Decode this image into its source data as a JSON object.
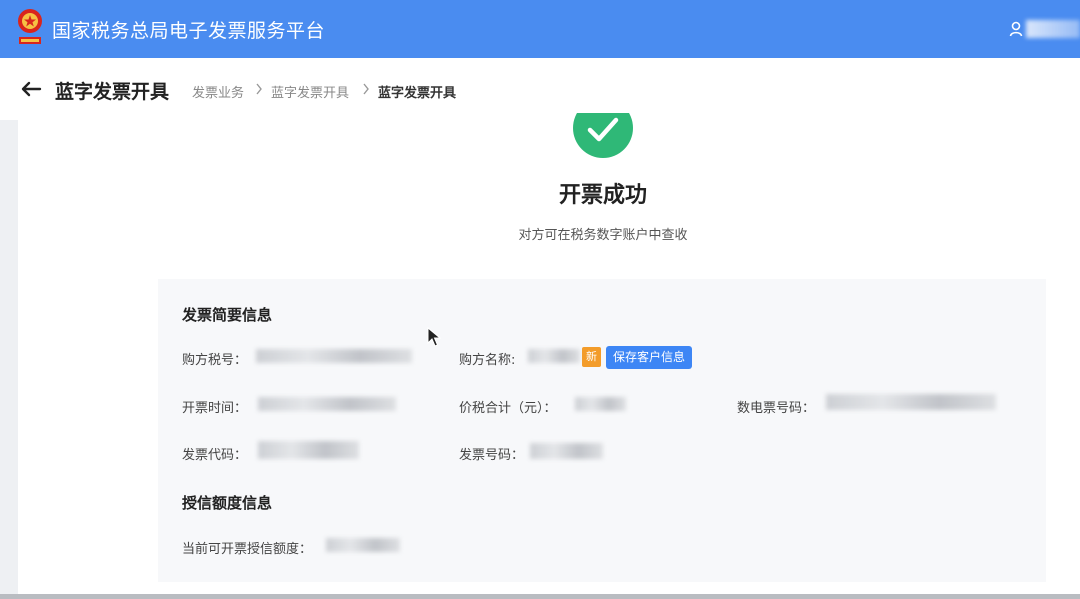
{
  "app": {
    "title": "国家税务总局电子发票服务平台"
  },
  "header": {
    "title": "蓝字发票开具",
    "breadcrumb": [
      "发票业务",
      "蓝字发票开具",
      "蓝字发票开具"
    ]
  },
  "result": {
    "title": "开票成功",
    "subtitle": "对方可在税务数字账户中查收"
  },
  "invoice_summary": {
    "title": "发票简要信息",
    "buyer_tax_id_label": "购方税号：",
    "buyer_name_label": "购方名称:",
    "new_badge": "新",
    "save_customer_button": "保存客户信息",
    "issue_time_label": "开票时间：",
    "total_amount_label": "价税合计（元）：",
    "e_invoice_number_label": "数电票号码：",
    "invoice_code_label": "发票代码：",
    "invoice_number_label": "发票号码："
  },
  "credit": {
    "title": "授信额度信息",
    "available_label": "当前可开票授信额度："
  },
  "colors": {
    "brand": "#4a8cf0",
    "success": "#2fb877",
    "badge": "#f39c2a",
    "button": "#3d86f5"
  },
  "icons": [
    "national-emblem-icon",
    "user-icon",
    "back-arrow-icon",
    "chevron-right-icon",
    "check-icon",
    "mouse-cursor-icon"
  ]
}
